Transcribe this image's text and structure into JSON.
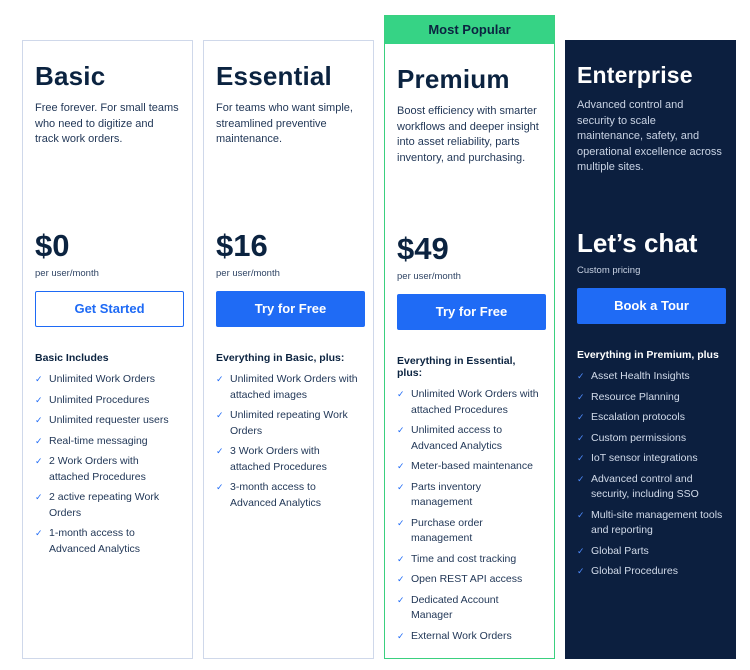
{
  "plans": [
    {
      "id": "basic",
      "name": "Basic",
      "description": "Free forever. For small teams who need to digitize and track work orders.",
      "price": "$0",
      "price_note": "per user/month",
      "cta_label": "Get Started",
      "includes_heading": "Basic Includes",
      "features": [
        "Unlimited Work Orders",
        "Unlimited Procedures",
        "Unlimited requester users",
        "Real-time messaging",
        "2 Work Orders with attached Procedures",
        "2 active repeating Work Orders",
        "1-month access to Advanced Analytics"
      ]
    },
    {
      "id": "essential",
      "name": "Essential",
      "description": "For teams who want simple, streamlined preventive maintenance.",
      "price": "$16",
      "price_note": "per user/month",
      "cta_label": "Try for Free",
      "includes_heading": "Everything in Basic, plus:",
      "features": [
        "Unlimited Work Orders with attached images",
        "Unlimited repeating Work Orders",
        "3 Work Orders with attached Procedures",
        "3-month access to Advanced Analytics"
      ]
    },
    {
      "id": "premium",
      "badge": "Most Popular",
      "name": "Premium",
      "description": "Boost efficiency with smarter workflows and deeper insight into asset reliability, parts inventory, and purchasing.",
      "price": "$49",
      "price_note": "per user/month",
      "cta_label": "Try for Free",
      "includes_heading": "Everything in Essential, plus:",
      "features": [
        "Unlimited Work Orders with attached Procedures",
        "Unlimited access to Advanced Analytics",
        "Meter-based maintenance",
        "Parts inventory management",
        "Purchase order management",
        "Time and cost tracking",
        "Open REST API access",
        "Dedicated Account Manager",
        "External Work Orders"
      ]
    },
    {
      "id": "enterprise",
      "name": "Enterprise",
      "description": "Advanced control and security to scale maintenance, safety, and operational excellence across multiple sites.",
      "price": "Let’s chat",
      "price_note": "Custom pricing",
      "cta_label": "Book a Tour",
      "includes_heading": "Everything in Premium, plus",
      "features": [
        "Asset Health Insights",
        "Resource Planning",
        "Escalation protocols",
        "Custom permissions",
        "IoT sensor integrations",
        "Advanced control and security, including SSO",
        "Multi-site management tools and reporting",
        "Global Parts",
        "Global Procedures"
      ]
    }
  ],
  "icons": {
    "feature_bullet": "checkmark-icon",
    "glyph": "✓"
  },
  "colors": {
    "accent_blue": "#1f6bf5",
    "popular_green": "#36d385",
    "enterprise_bg": "#0c1f3f",
    "text_dark": "#0b2340"
  }
}
